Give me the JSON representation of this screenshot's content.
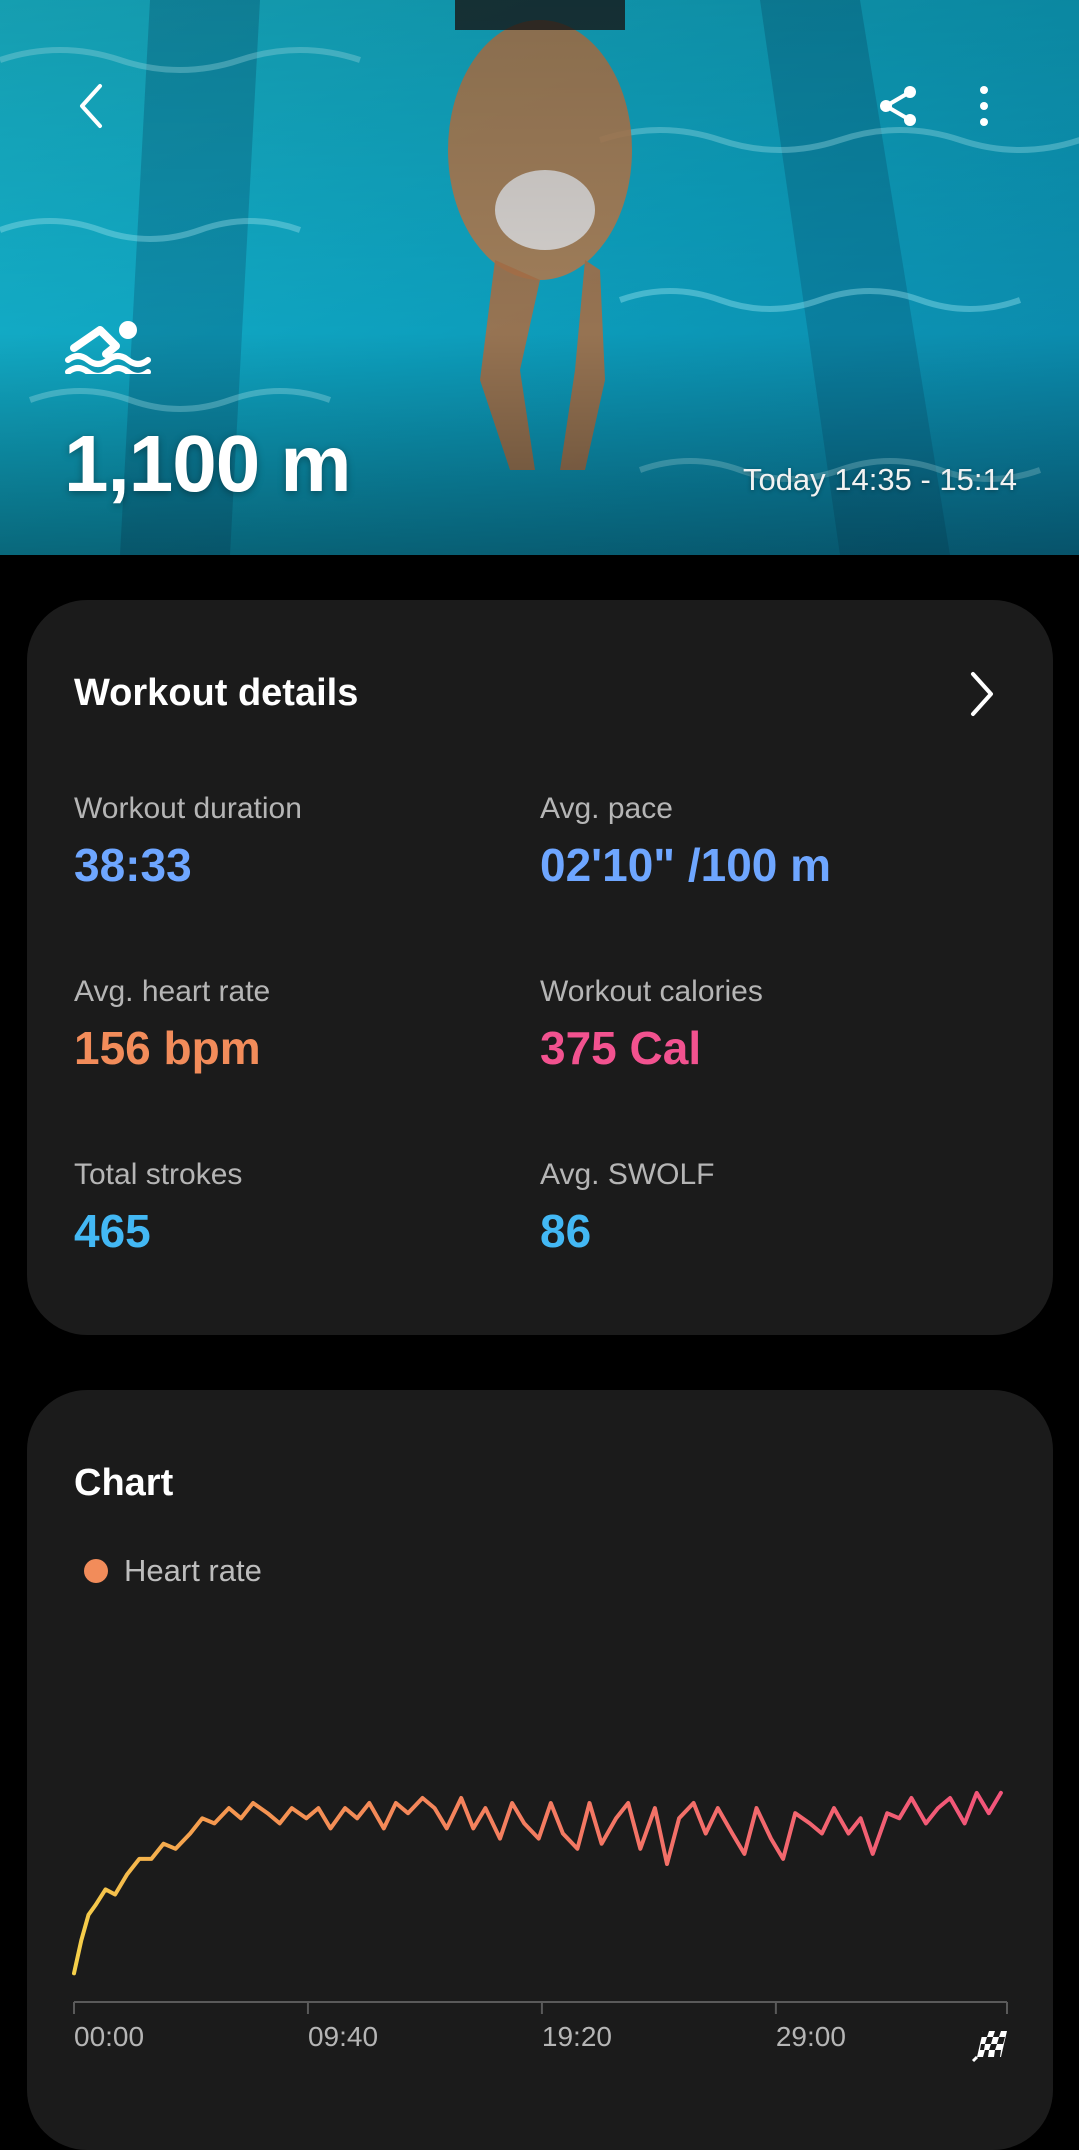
{
  "header": {
    "distance": "1,100 m",
    "time_range": "Today 14:35 - 15:14",
    "icons": {
      "back": "chevron-left-icon",
      "share": "share-icon",
      "more": "more-vertical-icon",
      "activity": "swimming-icon"
    }
  },
  "details": {
    "title": "Workout details",
    "stats": [
      {
        "label": "Workout duration",
        "value": "38:33",
        "color": "#6ea6ff"
      },
      {
        "label": "Avg. pace",
        "value": "02'10\" /100 m",
        "color": "#6ea6ff"
      },
      {
        "label": "Avg. heart rate",
        "value": "156 bpm",
        "color": "#f28c5a"
      },
      {
        "label": "Workout calories",
        "value": "375 Cal",
        "color": "#f2528f"
      },
      {
        "label": "Total strokes",
        "value": "465",
        "color": "#43b8f4"
      },
      {
        "label": "Avg. SWOLF",
        "value": "86",
        "color": "#43b8f4"
      }
    ]
  },
  "chart": {
    "title": "Chart",
    "legend": "Heart rate",
    "end_icon": "finish-flag-icon"
  },
  "chart_data": {
    "type": "line",
    "xlabel": "",
    "ylabel": "",
    "x_ticks": [
      "00:00",
      "09:40",
      "19:20",
      "29:00"
    ],
    "x_unit": "minutes",
    "xlim": [
      0,
      38.55
    ],
    "series": [
      {
        "name": "Heart rate",
        "color_start": "#f5d04a",
        "color_end": "#f2547a",
        "x": [
          0,
          0.3,
          0.6,
          0.9,
          1.3,
          1.7,
          2.2,
          2.7,
          3.2,
          3.7,
          4.2,
          4.8,
          5.3,
          5.8,
          6.4,
          6.9,
          7.4,
          8.0,
          8.5,
          9.0,
          9.6,
          10.1,
          10.6,
          11.2,
          11.7,
          12.2,
          12.8,
          13.3,
          13.8,
          14.4,
          14.9,
          15.4,
          16.0,
          16.5,
          17.0,
          17.6,
          18.1,
          18.6,
          19.2,
          19.7,
          20.2,
          20.8,
          21.3,
          21.8,
          22.4,
          22.9,
          23.4,
          24.0,
          24.5,
          25.0,
          25.6,
          26.1,
          26.6,
          27.2,
          27.7,
          28.2,
          28.8,
          29.3,
          29.8,
          30.4,
          30.9,
          31.4,
          32.0,
          32.5,
          33.0,
          33.6,
          34.1,
          34.6,
          35.2,
          35.7,
          36.2,
          36.8,
          37.3,
          37.8,
          38.3
        ],
        "values": [
          95,
          108,
          118,
          122,
          128,
          126,
          134,
          140,
          140,
          146,
          144,
          150,
          156,
          154,
          160,
          156,
          162,
          158,
          154,
          160,
          156,
          160,
          152,
          160,
          156,
          162,
          152,
          162,
          158,
          164,
          160,
          152,
          164,
          152,
          160,
          148,
          162,
          154,
          148,
          162,
          150,
          144,
          162,
          146,
          156,
          162,
          144,
          160,
          138,
          156,
          162,
          150,
          160,
          150,
          142,
          160,
          148,
          140,
          158,
          154,
          150,
          160,
          150,
          156,
          142,
          158,
          156,
          164,
          154,
          160,
          164,
          154,
          166,
          158,
          166
        ],
        "ylim": [
          90,
          175
        ]
      }
    ]
  }
}
